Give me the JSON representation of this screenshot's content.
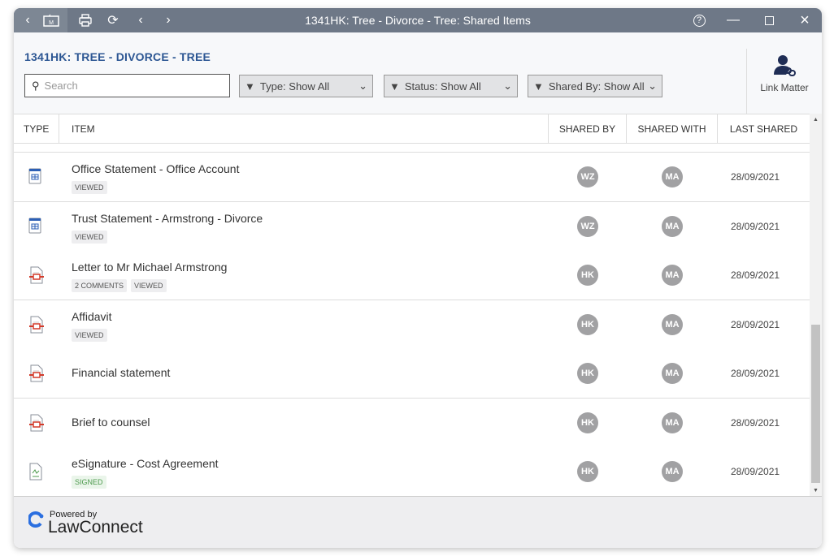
{
  "window": {
    "title": "1341HK: Tree - Divorce - Tree: Shared Items"
  },
  "header": {
    "matter": "1341HK: TREE - DIVORCE - TREE",
    "search_placeholder": "Search",
    "filters": [
      "Type: Show All",
      "Status: Show All",
      "Shared By: Show All"
    ],
    "link_matter": "Link Matter"
  },
  "columns": [
    "TYPE",
    "ITEM",
    "SHARED BY",
    "SHARED WITH",
    "LAST SHARED"
  ],
  "rows": [
    {
      "type": "statement",
      "name": "Office Statement - Office Account",
      "tags": [
        "VIEWED"
      ],
      "shared_by": "WZ",
      "shared_with": "MA",
      "date": "28/09/2021"
    },
    {
      "type": "statement",
      "name": "Trust Statement - Armstrong - Divorce",
      "tags": [
        "VIEWED"
      ],
      "shared_by": "WZ",
      "shared_with": "MA",
      "date": "28/09/2021"
    },
    {
      "type": "pdf",
      "name": "Letter to Mr Michael Armstrong",
      "tags": [
        "2 COMMENTS",
        "VIEWED"
      ],
      "shared_by": "HK",
      "shared_with": "MA",
      "date": "28/09/2021"
    },
    {
      "type": "pdf",
      "name": "Affidavit",
      "tags": [
        "VIEWED"
      ],
      "shared_by": "HK",
      "shared_with": "MA",
      "date": "28/09/2021"
    },
    {
      "type": "pdf",
      "name": "Financial statement",
      "tags": [],
      "shared_by": "HK",
      "shared_with": "MA",
      "date": "28/09/2021"
    },
    {
      "type": "pdf",
      "name": "Brief to counsel",
      "tags": [],
      "shared_by": "HK",
      "shared_with": "MA",
      "date": "28/09/2021"
    },
    {
      "type": "esign",
      "name": "eSignature - Cost Agreement",
      "tags": [
        "SIGNED"
      ],
      "shared_by": "HK",
      "shared_with": "MA",
      "date": "28/09/2021"
    }
  ],
  "footer": {
    "powered": "Powered by",
    "brand": "LawConnect"
  },
  "colors": {
    "titlebar": "#6e7887",
    "accent": "#2c5693",
    "brand": "#2b6fe0"
  }
}
